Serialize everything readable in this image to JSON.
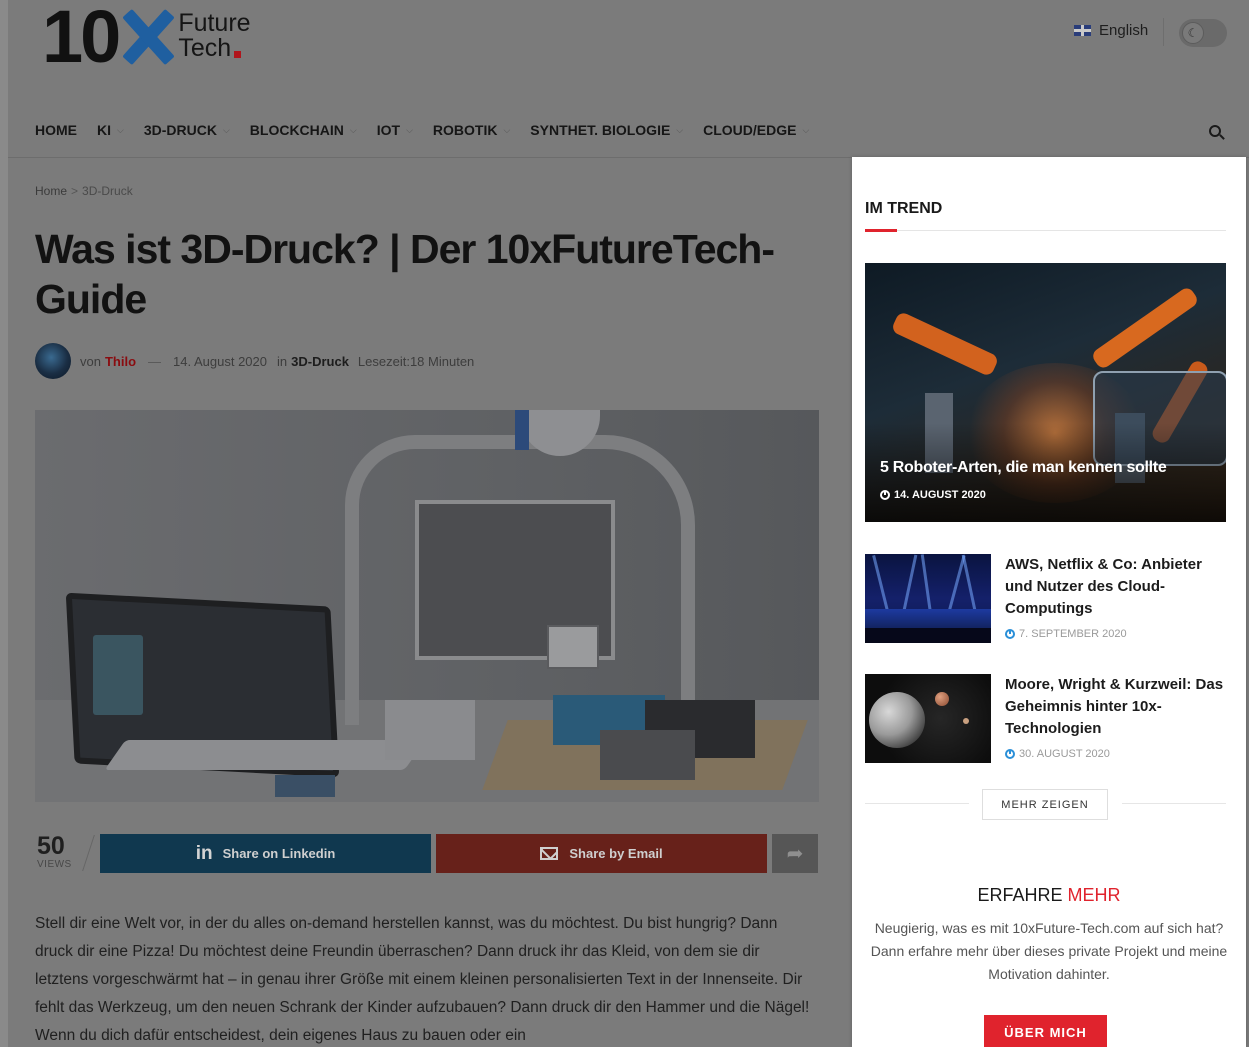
{
  "header": {
    "logo_number": "10",
    "logo_line1": "Future",
    "logo_line2": "Tech",
    "language": "English"
  },
  "nav": {
    "items": [
      {
        "label": "HOME",
        "has_dropdown": false
      },
      {
        "label": "KI",
        "has_dropdown": true
      },
      {
        "label": "3D-DRUCK",
        "has_dropdown": true
      },
      {
        "label": "BLOCKCHAIN",
        "has_dropdown": true
      },
      {
        "label": "IOT",
        "has_dropdown": true
      },
      {
        "label": "ROBOTIK",
        "has_dropdown": true
      },
      {
        "label": "SYNTHET. BIOLOGIE",
        "has_dropdown": true
      },
      {
        "label": "CLOUD/EDGE",
        "has_dropdown": true
      }
    ],
    "search_icon": "search-icon"
  },
  "breadcrumb": {
    "home": "Home",
    "separator": ">",
    "current": "3D-Druck"
  },
  "article": {
    "title": "Was ist 3D-Druck? | Der 10xFutureTech-Guide",
    "meta": {
      "by": "von",
      "author": "Thilo",
      "dash": "—",
      "date": "14. August 2020",
      "in": "in",
      "category": "3D-Druck",
      "reading_time": "Lesezeit:18 Minuten"
    },
    "views_count": "50",
    "views_label": "VIEWS",
    "share_linkedin": "Share on Linkedin",
    "share_email": "Share by Email",
    "body": "Stell dir eine Welt vor, in der du alles on-demand herstellen kannst, was du möchtest. Du bist hungrig? Dann druck dir eine Pizza! Du möchtest deine Freundin überraschen? Dann druck ihr das Kleid, von dem sie dir letztens vorgeschwärmt hat – in genau ihrer Größe mit einem kleinen personalisierten Text in der Innenseite. Dir fehlt das Werkzeug, um den neuen Schrank der Kinder aufzubauen? Dann druck dir den Hammer und die Nägel! Wenn du dich dafür entscheidest, dein eigenes Haus zu bauen oder ein"
  },
  "sidebar": {
    "heading": "IM TREND",
    "featured": {
      "title": "5 Roboter-Arten, die man kennen sollte",
      "date": "14. AUGUST 2020"
    },
    "items": [
      {
        "title": "AWS, Netflix & Co: Anbieter und Nutzer des Cloud-Computings",
        "date": "7. SEPTEMBER 2020"
      },
      {
        "title": "Moore, Wright & Kurzweil: Das Geheimnis hinter 10x-Technologien",
        "date": "30. AUGUST 2020"
      }
    ],
    "more_button": "MEHR ZEIGEN",
    "learn_title_a": "ERFAHRE",
    "learn_title_b": "MEHR",
    "learn_text": "Neugierig, was es mit 10xFuture-Tech.com auf sich hat? Dann erfahre mehr über dieses private Projekt und meine Motivation dahinter.",
    "about_button": "ÜBER MICH"
  },
  "colors": {
    "accent_red": "#e0232d",
    "linkedin": "#0077b5",
    "email": "#dd4b39",
    "logo_blue": "#1f5fa0"
  }
}
